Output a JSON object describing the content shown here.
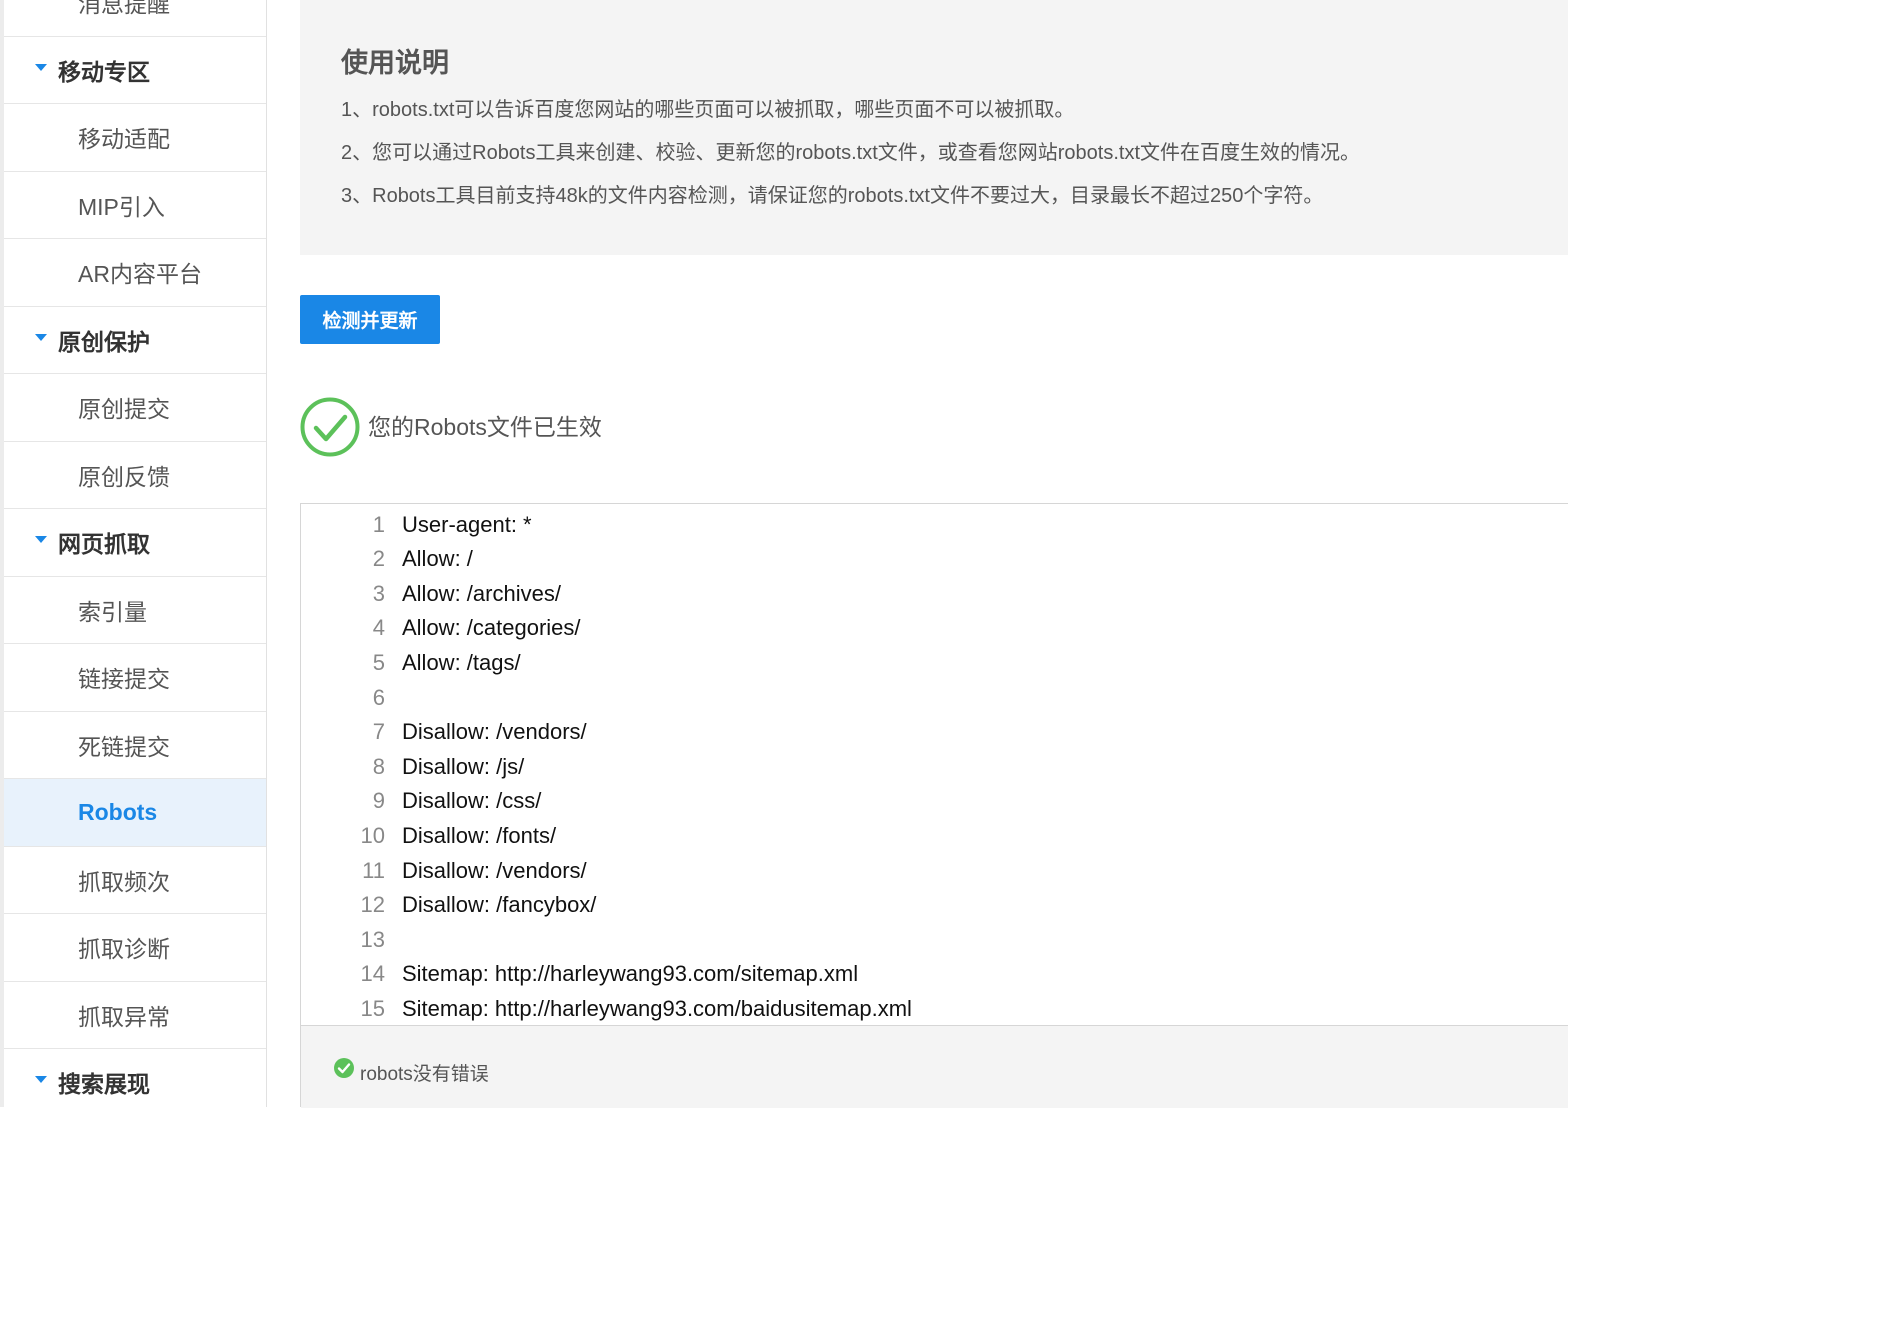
{
  "sidebar": {
    "items": [
      {
        "label": "消息提醒",
        "kind": "child"
      },
      {
        "label": "移动专区",
        "kind": "group"
      },
      {
        "label": "移动适配",
        "kind": "child"
      },
      {
        "label": "MIP引入",
        "kind": "child"
      },
      {
        "label": "AR内容平台",
        "kind": "child"
      },
      {
        "label": "原创保护",
        "kind": "group"
      },
      {
        "label": "原创提交",
        "kind": "child"
      },
      {
        "label": "原创反馈",
        "kind": "child"
      },
      {
        "label": "网页抓取",
        "kind": "group"
      },
      {
        "label": "索引量",
        "kind": "child"
      },
      {
        "label": "链接提交",
        "kind": "child"
      },
      {
        "label": "死链提交",
        "kind": "child"
      },
      {
        "label": "Robots",
        "kind": "child",
        "active": true
      },
      {
        "label": "抓取频次",
        "kind": "child"
      },
      {
        "label": "抓取诊断",
        "kind": "child"
      },
      {
        "label": "抓取异常",
        "kind": "child"
      },
      {
        "label": "搜索展现",
        "kind": "group"
      }
    ]
  },
  "usage": {
    "title": "使用说明",
    "lines": [
      "1、robots.txt可以告诉百度您网站的哪些页面可以被抓取，哪些页面不可以被抓取。",
      "2、您可以通过Robots工具来创建、校验、更新您的robots.txt文件，或查看您网站robots.txt文件在百度生效的情况。",
      "3、Robots工具目前支持48k的文件内容检测，请保证您的robots.txt文件不要过大，目录最长不超过250个字符。"
    ]
  },
  "actions": {
    "check_update_label": "检测并更新"
  },
  "status": {
    "message": "您的Robots文件已生效",
    "icon": "check-circle-icon"
  },
  "editor": {
    "lines": [
      {
        "num": "1",
        "text": "User-agent: *"
      },
      {
        "num": "2",
        "text": "Allow: /"
      },
      {
        "num": "3",
        "text": "Allow: /archives/"
      },
      {
        "num": "4",
        "text": "Allow: /categories/"
      },
      {
        "num": "5",
        "text": "Allow: /tags/"
      },
      {
        "num": "6",
        "text": ""
      },
      {
        "num": "7",
        "text": "Disallow: /vendors/"
      },
      {
        "num": "8",
        "text": "Disallow: /js/"
      },
      {
        "num": "9",
        "text": "Disallow: /css/"
      },
      {
        "num": "10",
        "text": "Disallow: /fonts/"
      },
      {
        "num": "11",
        "text": "Disallow: /vendors/"
      },
      {
        "num": "12",
        "text": "Disallow: /fancybox/"
      },
      {
        "num": "13",
        "text": ""
      },
      {
        "num": "14",
        "text": "Sitemap: http://harleywang93.com/sitemap.xml"
      },
      {
        "num": "15",
        "text": "Sitemap: http://harleywang93.com/baidusitemap.xml"
      }
    ],
    "footer_message": "robots没有错误"
  },
  "colors": {
    "accent": "#1a87e6",
    "success": "#5cc15a",
    "panel_bg": "#f4f4f4",
    "active_bg": "#e8f2fc"
  }
}
